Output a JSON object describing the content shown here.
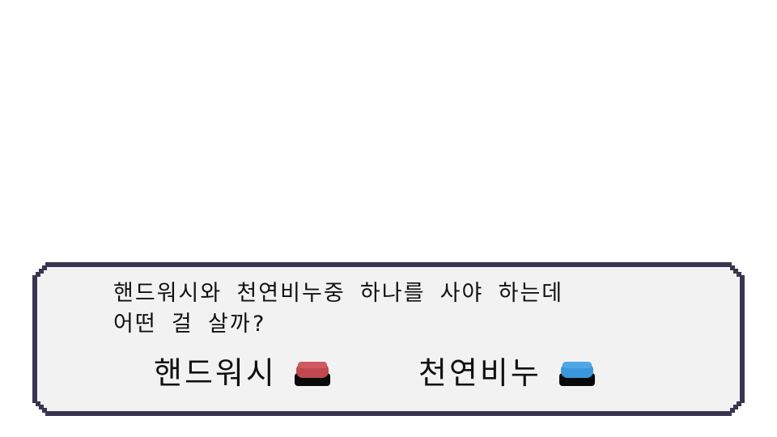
{
  "dialog": {
    "text": "핸드워시와 천연비누중 하나를 사야 하는데\n어떤 걸 살까?",
    "choices": [
      {
        "label": "핸드워시",
        "button_color": "#c0484f",
        "button_icon": "red-button-icon"
      },
      {
        "label": "천연비누",
        "button_color": "#3a97db",
        "button_icon": "blue-button-icon"
      }
    ]
  },
  "colors": {
    "frame": "#3b3450",
    "box_fill": "#f2f2f2",
    "background": "#ffffff"
  }
}
